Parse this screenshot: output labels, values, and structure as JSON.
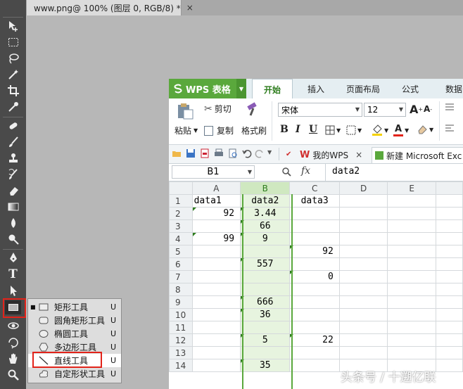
{
  "ps": {
    "tab_title": "www.png@ 100% (图层 0, RGB/8) *",
    "tab_close": "×",
    "tools": [
      {
        "icon": "move-icon"
      },
      {
        "icon": "marquee-icon"
      },
      {
        "icon": "lasso-icon"
      },
      {
        "icon": "magic-wand-icon"
      },
      {
        "icon": "crop-icon"
      },
      {
        "icon": "eyedropper-icon"
      },
      {
        "icon": "healing-brush-icon"
      },
      {
        "icon": "brush-icon"
      },
      {
        "icon": "clone-stamp-icon"
      },
      {
        "icon": "history-brush-icon"
      },
      {
        "icon": "eraser-icon"
      },
      {
        "icon": "gradient-icon"
      },
      {
        "icon": "blur-icon"
      },
      {
        "icon": "dodge-icon"
      },
      {
        "icon": "pen-icon"
      },
      {
        "icon": "type-icon"
      },
      {
        "icon": "path-selection-icon"
      },
      {
        "icon": "rectangle-tool-icon"
      },
      {
        "icon": "3d-rotate-icon"
      },
      {
        "icon": "3d-orbit-icon"
      },
      {
        "icon": "hand-icon"
      },
      {
        "icon": "zoom-icon"
      }
    ],
    "type_tool_glyph": "T",
    "flyout": [
      {
        "label": "矩形工具",
        "key": "U",
        "icon": "rectangle-shape-icon",
        "active": true
      },
      {
        "label": "圆角矩形工具",
        "key": "U",
        "icon": "rounded-rectangle-icon"
      },
      {
        "label": "椭圆工具",
        "key": "U",
        "icon": "ellipse-icon"
      },
      {
        "label": "多边形工具",
        "key": "U",
        "icon": "polygon-icon"
      },
      {
        "label": "直线工具",
        "key": "U",
        "icon": "line-icon",
        "highlighted": true
      },
      {
        "label": "自定形状工具",
        "key": "U",
        "icon": "custom-shape-icon"
      }
    ],
    "active_bullet": "■"
  },
  "wps": {
    "app_name": "WPS 表格",
    "ribbon_tabs": [
      "开始",
      "插入",
      "页面布局",
      "公式",
      "数据"
    ],
    "active_tab": "开始",
    "clipboard": {
      "paste": "粘贴",
      "cut": "剪切",
      "copy": "复制",
      "format_painter": "格式刷"
    },
    "font_name": "宋体",
    "font_size": "12",
    "format_buttons": [
      "B",
      "I",
      "U"
    ],
    "font_grow": "A",
    "font_shrink": "A",
    "doc_tabs": [
      {
        "label": "我的WPS",
        "close": "×"
      },
      {
        "label": "新建 Microsoft Exc"
      }
    ],
    "name_box": "B1",
    "fx_label": "fx",
    "formula_value": "data2",
    "columns": [
      "A",
      "B",
      "C",
      "D",
      "E"
    ],
    "rows": [
      {
        "n": "1",
        "A": "data1",
        "B": "data2",
        "C": "data3"
      },
      {
        "n": "2",
        "A": "92",
        "B": "3.44",
        "C": ""
      },
      {
        "n": "3",
        "A": "",
        "B": "66",
        "C": ""
      },
      {
        "n": "4",
        "A": "99",
        "B": "9",
        "C": ""
      },
      {
        "n": "5",
        "A": "",
        "B": "",
        "C": "92"
      },
      {
        "n": "6",
        "A": "",
        "B": "557",
        "C": ""
      },
      {
        "n": "7",
        "A": "",
        "B": "",
        "C": "0"
      },
      {
        "n": "8",
        "A": "",
        "B": "",
        "C": ""
      },
      {
        "n": "9",
        "A": "",
        "B": "666",
        "C": ""
      },
      {
        "n": "10",
        "A": "",
        "B": "36",
        "C": ""
      },
      {
        "n": "11",
        "A": "",
        "B": "",
        "C": ""
      },
      {
        "n": "12",
        "A": "",
        "B": "5",
        "C": "22"
      },
      {
        "n": "13",
        "A": "",
        "B": "",
        "C": ""
      },
      {
        "n": "14",
        "A": "",
        "B": "35",
        "C": ""
      }
    ],
    "accent_green": "#5aa83c"
  },
  "watermark": "头条号 / 十遡亿联"
}
